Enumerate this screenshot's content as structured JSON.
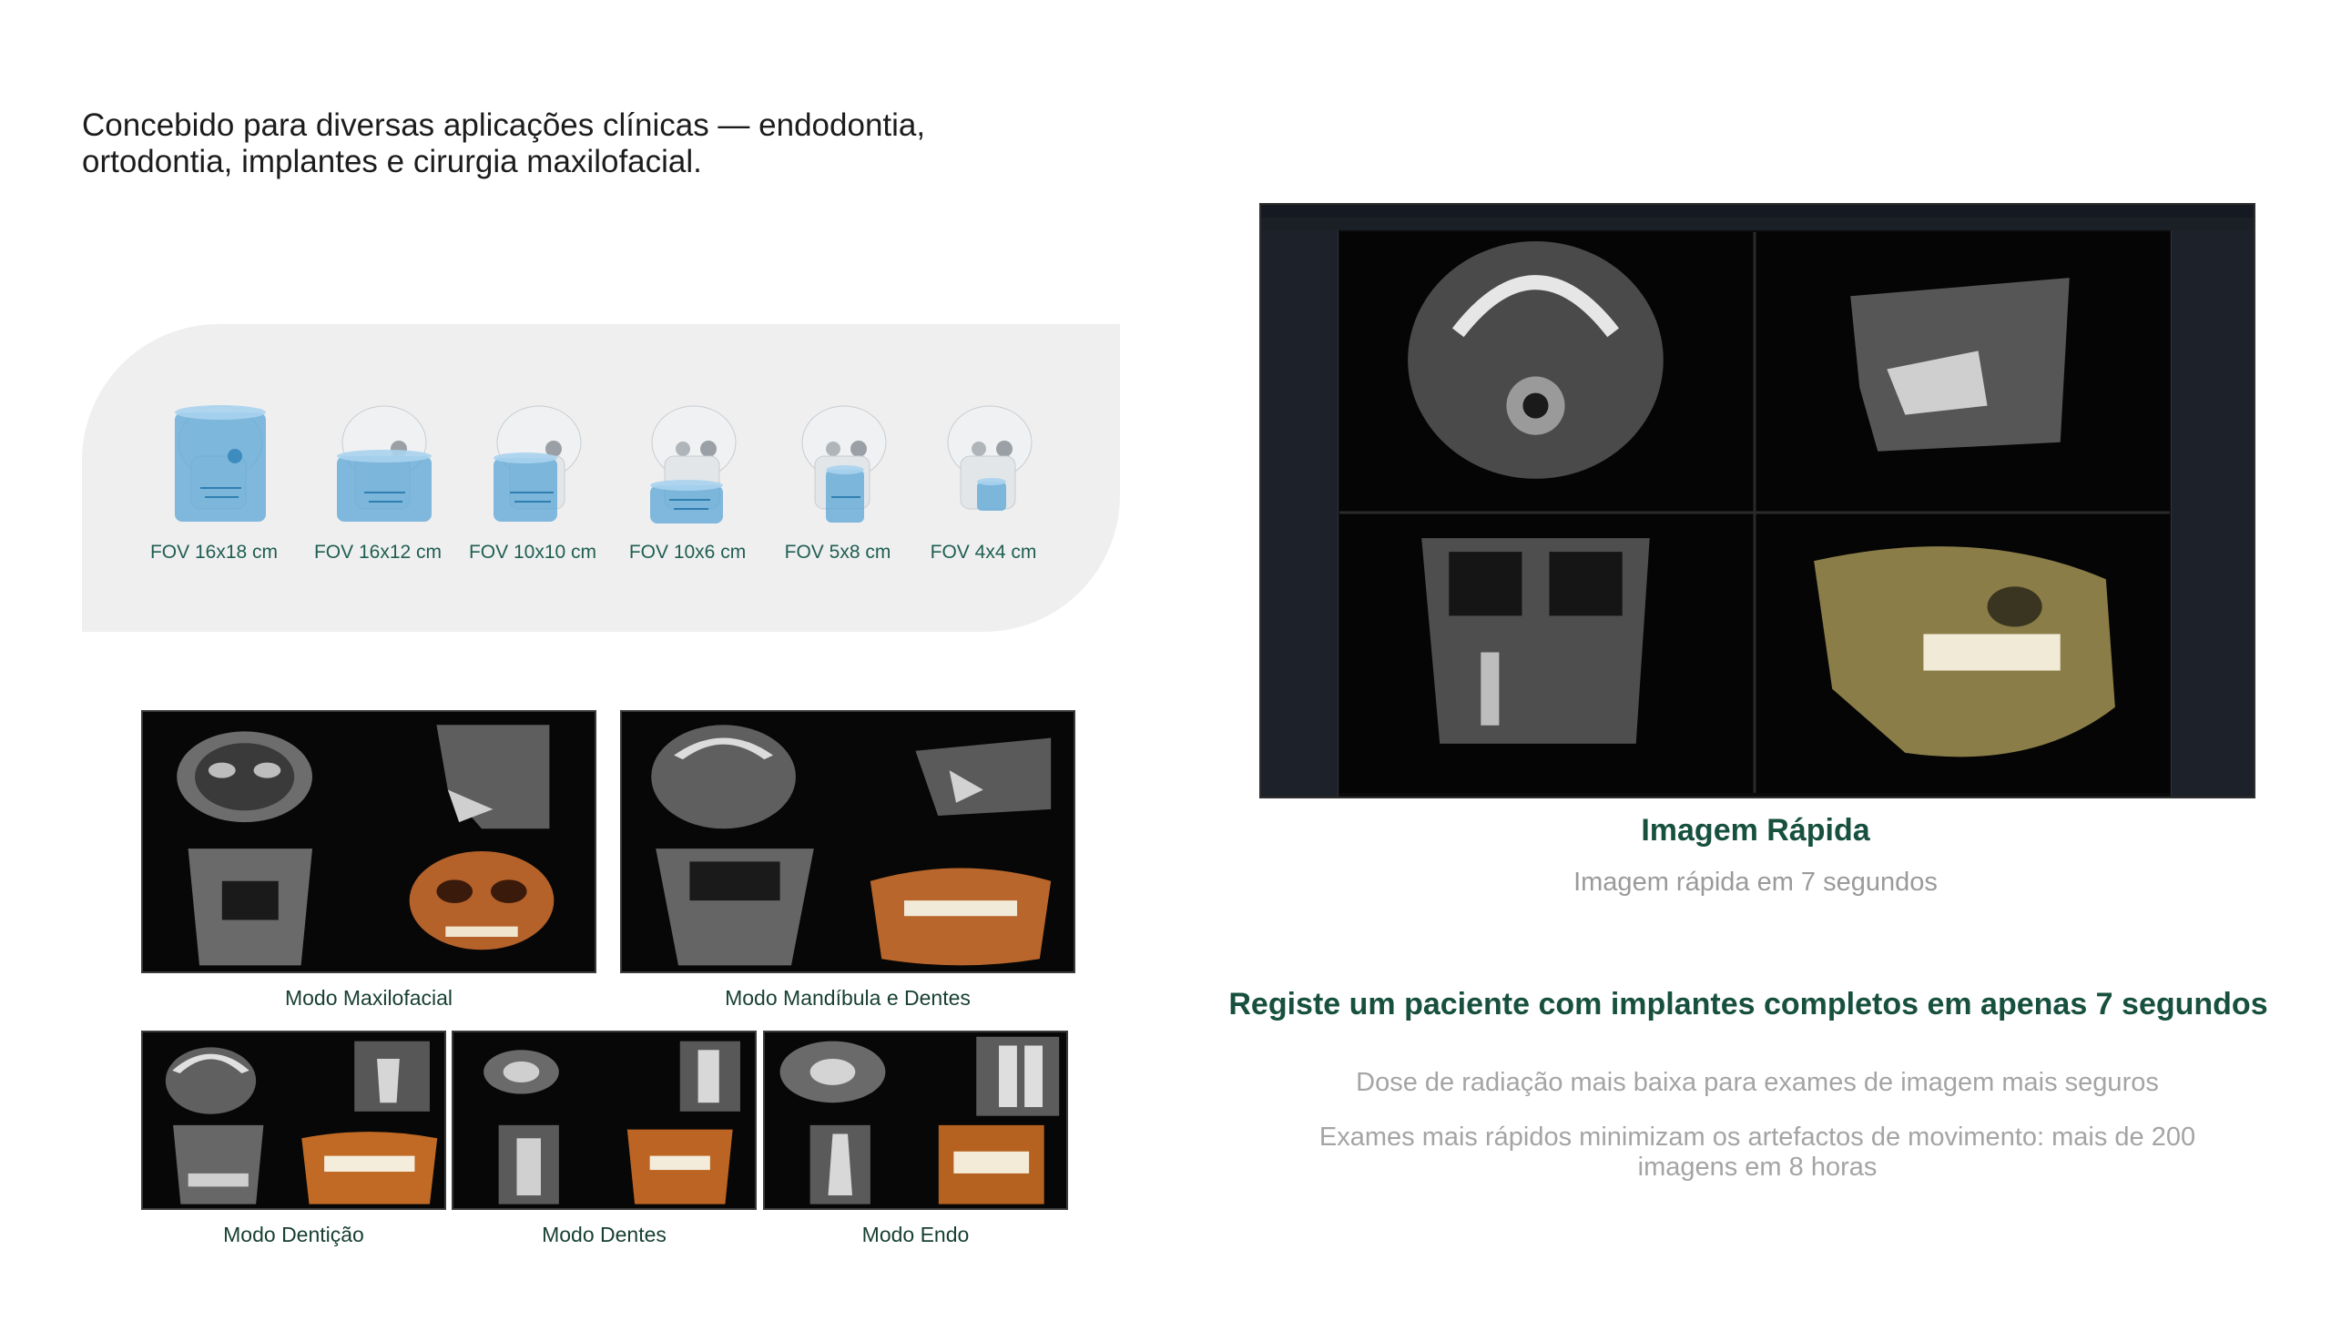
{
  "intro": {
    "line1": "Concebido para diversas aplicações clínicas — endodontia,",
    "line2": "ortodontia, implantes e cirurgia maxilofacial."
  },
  "fov": {
    "items": [
      {
        "label": "FOV 16x18 cm"
      },
      {
        "label": "FOV 16x12 cm"
      },
      {
        "label": "FOV 10x10 cm"
      },
      {
        "label": "FOV 10x6 cm"
      },
      {
        "label": "FOV 5x8 cm"
      },
      {
        "label": "FOV 4x4 cm"
      }
    ]
  },
  "modes": {
    "maxilofacial": "Modo Maxilofacial",
    "mandibula": "Modo Mandíbula e Dentes",
    "denticao": "Modo Dentição",
    "dentes": "Modo Dentes",
    "endo": "Modo Endo"
  },
  "quick": {
    "title": "Imagem Rápida",
    "subtitle": "Imagem rápida em 7 segundos"
  },
  "register": "Registe um paciente com implantes completos em apenas 7 segundos",
  "benefits": {
    "dose": "Dose de radiação mais baixa para exames de imagem mais seguros",
    "speed_line1": "Exames mais rápidos minimizam os artefactos de movimento: mais de 200",
    "speed_line2": "imagens em 8 horas"
  },
  "colors": {
    "accent_green": "#17503e",
    "label_teal": "#1f5e52",
    "muted_gray": "#9a9a9a",
    "panel_bg": "#efefef"
  }
}
